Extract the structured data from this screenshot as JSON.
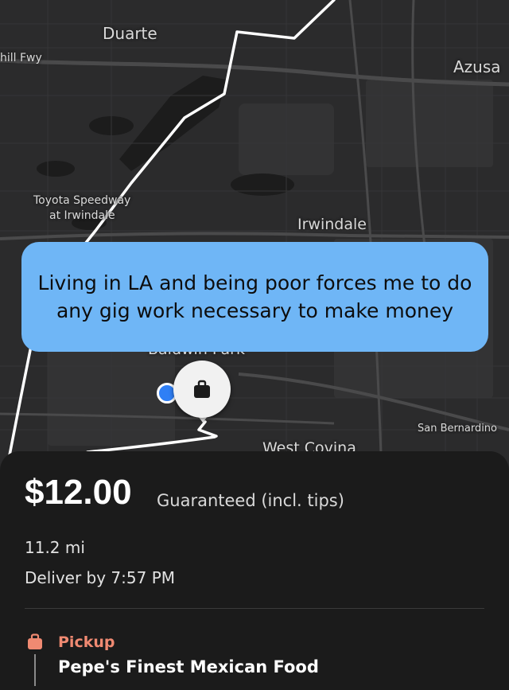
{
  "map": {
    "labels": {
      "duarte": "Duarte",
      "foothill": "hill Fwy",
      "azusa": "Azusa",
      "speedway_line1": "Toyota Speedway",
      "speedway_line2": "at Irwindale",
      "irwindale": "Irwindale",
      "baldwin": "Baldwin Park",
      "san_bernardino": "San Bernardino",
      "west_covina": "West Covina"
    },
    "route_color": "#ffffff",
    "location_dot_color": "#2f7ff5",
    "pin_icon": "shopping-bag-icon"
  },
  "caption": {
    "text": "Living in LA and being poor forces me to do any gig work necessary to make money",
    "color": "#6fb6f6"
  },
  "offer": {
    "price": "$12.00",
    "price_note": "Guaranteed (incl. tips)",
    "distance": "11.2 mi",
    "deliver_by": "Deliver by 7:57 PM",
    "pickup": {
      "label": "Pickup",
      "name": "Pepe's Finest Mexican Food",
      "icon": "shopping-bag-icon",
      "accent": "#f08a72"
    }
  }
}
